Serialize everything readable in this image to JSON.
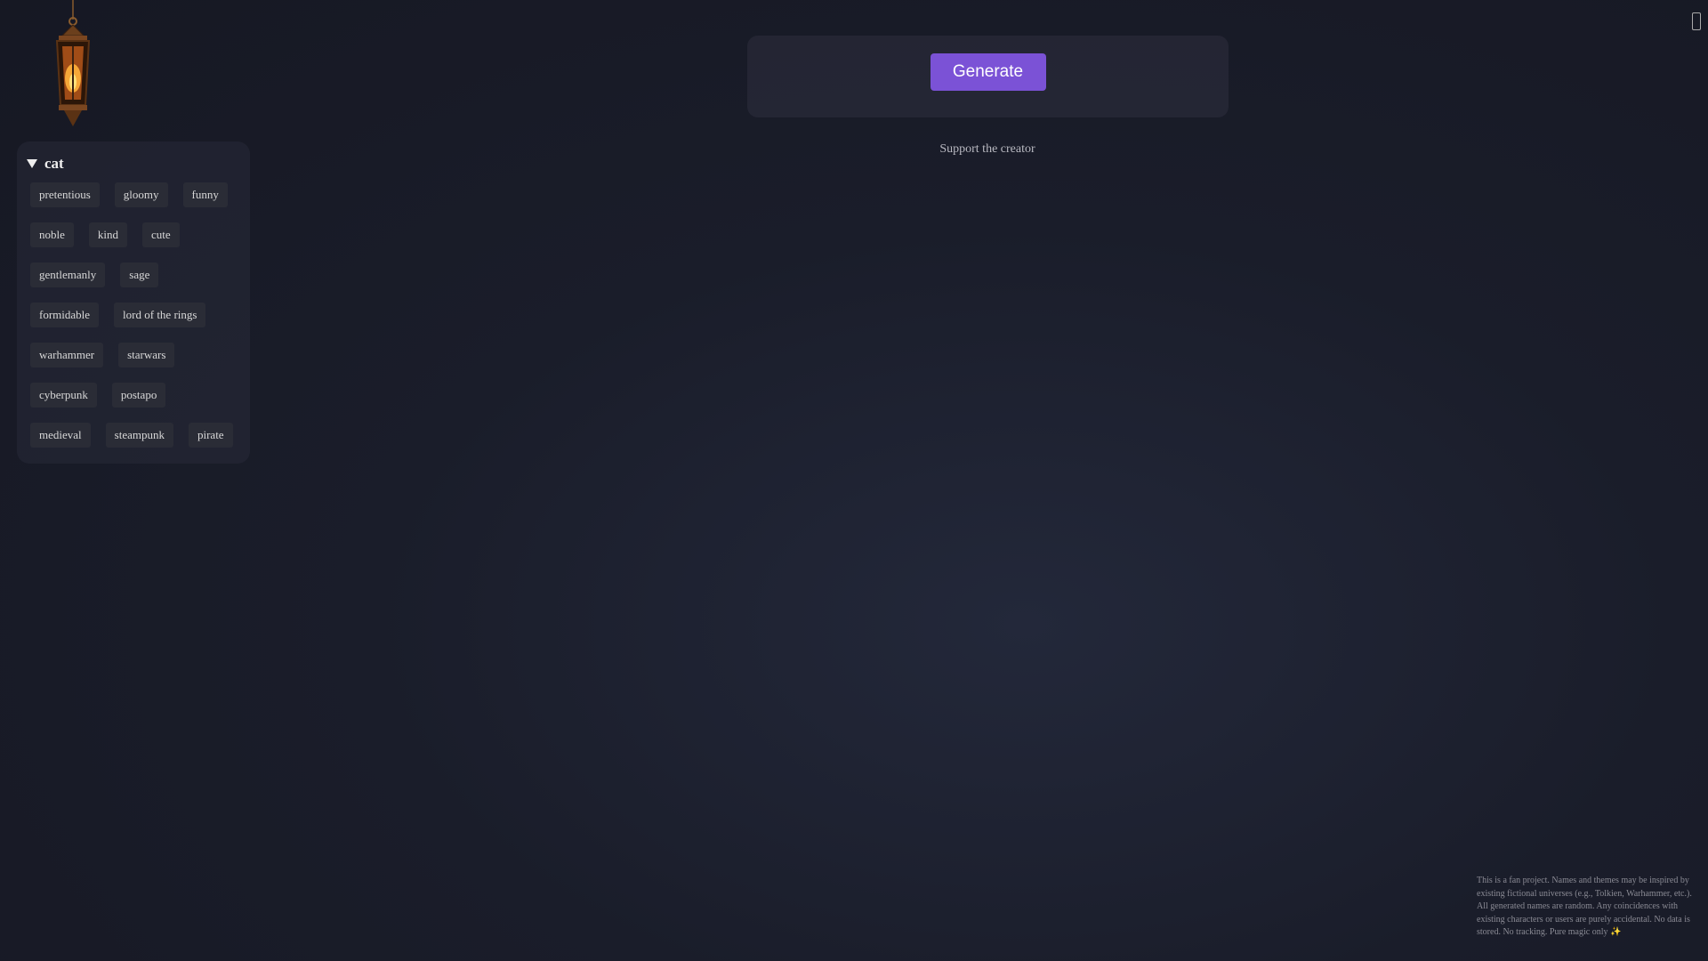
{
  "sidebar": {
    "category": "cat",
    "tag_rows": [
      [
        "pretentious",
        "gloomy",
        "funny"
      ],
      [
        "noble",
        "kind",
        "cute"
      ],
      [
        "gentlemanly",
        "sage"
      ],
      [
        "formidable",
        "lord of the rings"
      ],
      [
        "warhammer",
        "starwars"
      ],
      [
        "cyberpunk",
        "postapo"
      ],
      [
        "medieval",
        "steampunk",
        "pirate"
      ]
    ]
  },
  "generator": {
    "button_label": "Generate"
  },
  "support": {
    "link_text": "Support the creator"
  },
  "icons": {
    "lantern": "lantern-icon",
    "corner": "menu-icon",
    "collapse": "triangle-down-icon"
  },
  "colors": {
    "accent": "#7b52d6",
    "background": "#1a1d2a",
    "panel": "#282a38"
  },
  "footer": {
    "disclaimer": "This is a fan project. Names and themes may be inspired by existing fictional universes (e.g., Tolkien, Warhammer, etc.). All generated names are random. Any coincidences with existing characters or users are purely accidental. No data is stored. No tracking. Pure magic only ✨"
  }
}
